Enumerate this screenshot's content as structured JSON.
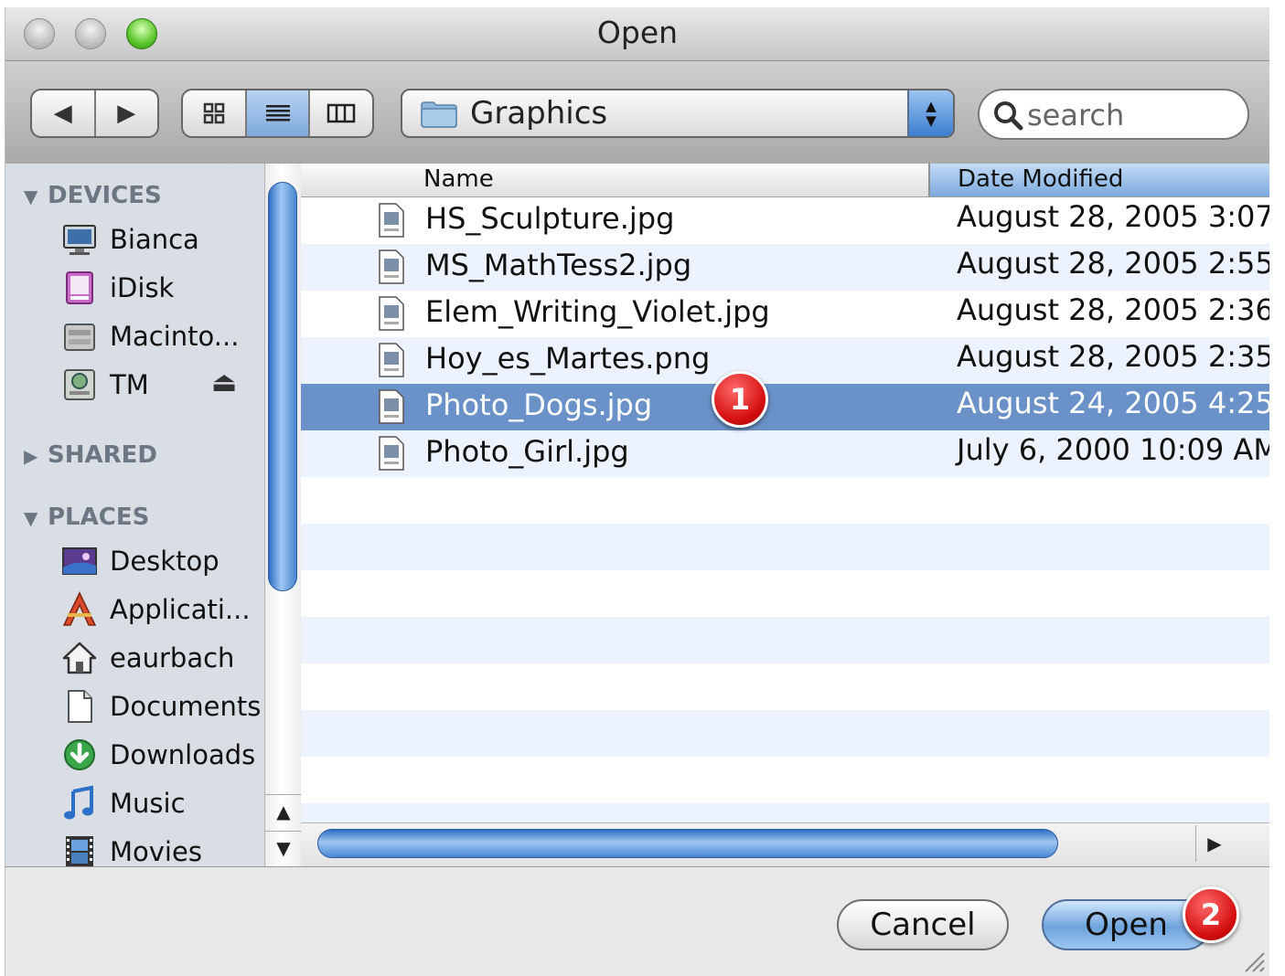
{
  "window": {
    "title": "Open"
  },
  "toolbar": {
    "location": "Graphics",
    "search_placeholder": "search"
  },
  "sidebar": {
    "sections": [
      {
        "label": "DEVICES",
        "expanded": true
      },
      {
        "label": "SHARED",
        "expanded": false
      },
      {
        "label": "PLACES",
        "expanded": true
      }
    ],
    "devices": [
      "Bianca",
      "iDisk",
      "Macinto...",
      "TM"
    ],
    "places": [
      "Desktop",
      "Applicati...",
      "eaurbach",
      "Documents",
      "Downloads",
      "Music",
      "Movies"
    ]
  },
  "filelist": {
    "columns": {
      "name": "Name",
      "date": "Date Modified"
    },
    "files": [
      {
        "name": "HS_Sculpture.jpg",
        "date": "August 28, 2005 3:07"
      },
      {
        "name": "MS_MathTess2.jpg",
        "date": "August 28, 2005 2:55"
      },
      {
        "name": "Elem_Writing_Violet.jpg",
        "date": "August 28, 2005 2:36"
      },
      {
        "name": "Hoy_es_Martes.png",
        "date": "August 28, 2005 2:35"
      },
      {
        "name": "Photo_Dogs.jpg",
        "date": "August 24, 2005 4:25",
        "selected": true
      },
      {
        "name": "Photo_Girl.jpg",
        "date": "July 6, 2000 10:09 AM"
      }
    ]
  },
  "buttons": {
    "cancel": "Cancel",
    "open": "Open"
  },
  "callouts": [
    "1",
    "2"
  ],
  "colors": {
    "selection": "#6a92c8",
    "accent": "#3c7fd0",
    "badge": "#d40f0f"
  }
}
